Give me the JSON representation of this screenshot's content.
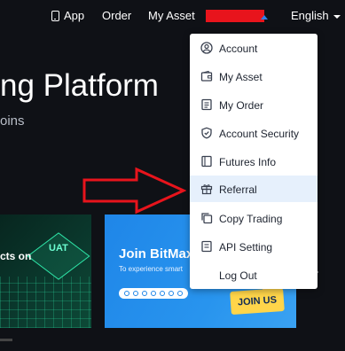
{
  "nav": {
    "app": "App",
    "order": "Order",
    "my_asset": "My Asset",
    "language": "English"
  },
  "hero": {
    "title": "ng Platform",
    "subtitle": "oins"
  },
  "banners": [
    {
      "text": "cts on",
      "chip": "UAT"
    },
    {
      "title": "Join BitMax",
      "subtitle": "To experience smart",
      "badge": "JOIN US"
    }
  ],
  "dropdown": {
    "items": [
      {
        "label": "Account",
        "icon": "user-circle-icon"
      },
      {
        "label": "My Asset",
        "icon": "wallet-icon"
      },
      {
        "label": "My Order",
        "icon": "document-list-icon"
      },
      {
        "label": "Account Security",
        "icon": "shield-icon"
      },
      {
        "label": "Futures Info",
        "icon": "futures-book-icon"
      },
      {
        "label": "Referral",
        "icon": "gift-icon"
      },
      {
        "label": "Copy Trading",
        "icon": "copy-icon"
      },
      {
        "label": "API Setting",
        "icon": "api-doc-icon"
      },
      {
        "label": "Log Out",
        "icon": ""
      }
    ],
    "highlighted": "Referral"
  },
  "colors": {
    "background": "#0f1116",
    "accent_blue": "#2f7fe8",
    "redaction": "#e8141c",
    "annotation_arrow": "#e8141c",
    "hover_bg": "#e6f0fc"
  }
}
